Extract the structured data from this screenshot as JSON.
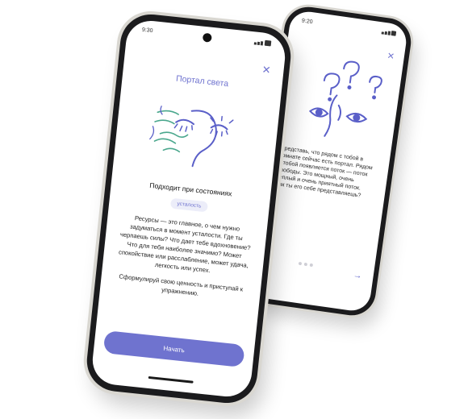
{
  "front": {
    "status_time": "9:30",
    "title": "Портал света",
    "heading": "Подходит при состояниях",
    "tag": "усталость",
    "paragraph1": "Ресурсы — это главное, о чем нужно задуматься в момент усталости. Где ты черпаешь силы? Что дает тебе вдохновение? Что для тебя наиболее значимо? Может спокойствие или расслабление, может удача, легкость или успех.",
    "paragraph2": "Сформулируй свою ценность и приступай к упражнению.",
    "cta": "Начать",
    "colors": {
      "accent": "#6f73cf",
      "art_stroke": "#5a5fc8",
      "art_green": "#4aa78d"
    }
  },
  "back": {
    "status_time": "9:20",
    "text": "Представь, что рядом с тобой в комнате сейчас есть портал. Рядом с тобой появляется поток — поток свободы. Это мощный, очень теплый и очень приятный поток. Как ты его себе представляешь?",
    "icons": [
      "question-icon",
      "eye-icon"
    ]
  },
  "icons": [
    "close-icon",
    "arrow-right-icon",
    "signal-icon",
    "battery-icon"
  ]
}
